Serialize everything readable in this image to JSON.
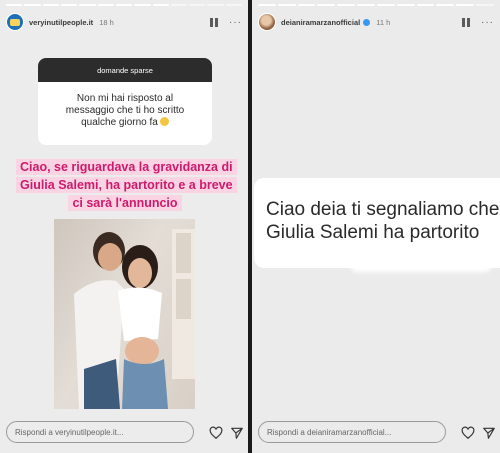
{
  "left_story": {
    "username": "veryinutilpeople.it",
    "time": "18 h",
    "question": {
      "header": "domande sparse",
      "text": "Non mi hai risposto al messaggio che ti ho scritto qualche giorno fa"
    },
    "answer": "Ciao, se riguardava la gravidanza di Giulia Salemi, ha partorito e a breve ci sarà l'annuncio",
    "photo": "couple-photo",
    "reply_placeholder": "Rispondi a veryinutilpeople.it..."
  },
  "right_story": {
    "username": "deianiramarzanofficial",
    "time": "11 h",
    "message": "Ciao deia ti segnaliamo che Giulia Salemi ha partorito",
    "reply_placeholder": "Rispondi a deianiramarzanofficial..."
  },
  "icons": [
    "pause-icon",
    "more-icon",
    "heart-icon",
    "send-icon",
    "verified-icon"
  ],
  "colors": {
    "answer_text": "#cc1a6c",
    "answer_highlight": "#fbd4e4",
    "question_header": "#2c2c2c",
    "verified": "#3897f0"
  }
}
